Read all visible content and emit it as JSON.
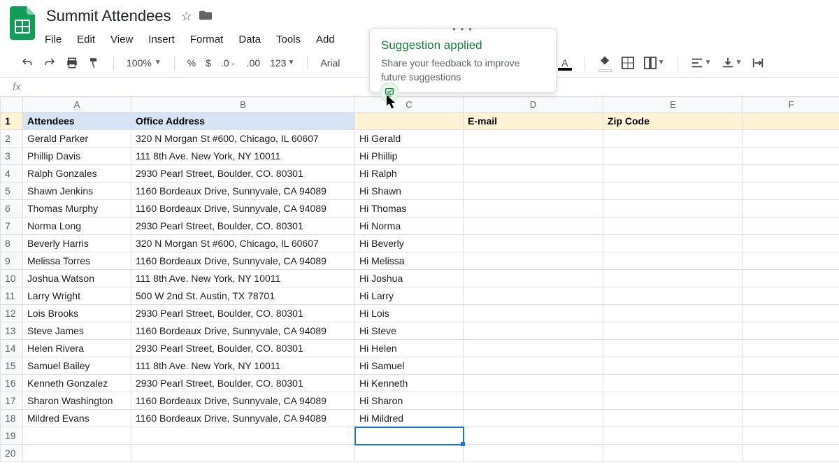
{
  "doc": {
    "title": "Summit Attendees"
  },
  "menu": {
    "file": "File",
    "edit": "Edit",
    "view": "View",
    "insert": "Insert",
    "format": "Format",
    "data": "Data",
    "tools": "Tools",
    "add": "Add"
  },
  "toolbar": {
    "zoom": "100%",
    "numfmt": "123",
    "font": "Arial"
  },
  "suggestion": {
    "title": "Suggestion applied",
    "body": "Share your feedback to improve future suggestions"
  },
  "columns": [
    "A",
    "B",
    "C",
    "D",
    "E",
    "F"
  ],
  "headers": {
    "A": "Attendees",
    "B": "Office Address",
    "C": "",
    "D": "E-mail",
    "E": "Zip Code",
    "F": ""
  },
  "rows": [
    {
      "n": "2",
      "a": "Gerald Parker",
      "b": "320 N Morgan St #600, Chicago, IL 60607",
      "c": "Hi Gerald"
    },
    {
      "n": "3",
      "a": "Phillip Davis",
      "b": "111 8th Ave. New York, NY 10011",
      "c": "Hi Phillip"
    },
    {
      "n": "4",
      "a": "Ralph Gonzales",
      "b": "2930 Pearl Street, Boulder, CO. 80301",
      "c": "Hi Ralph"
    },
    {
      "n": "5",
      "a": "Shawn Jenkins",
      "b": "1160 Bordeaux Drive, Sunnyvale, CA 94089",
      "c": "Hi Shawn"
    },
    {
      "n": "6",
      "a": "Thomas Murphy",
      "b": "1160 Bordeaux Drive, Sunnyvale, CA 94089",
      "c": "Hi Thomas"
    },
    {
      "n": "7",
      "a": "Norma Long",
      "b": "2930 Pearl Street, Boulder, CO. 80301",
      "c": "Hi Norma"
    },
    {
      "n": "8",
      "a": "Beverly Harris",
      "b": "320 N Morgan St #600, Chicago, IL 60607",
      "c": "Hi Beverly"
    },
    {
      "n": "9",
      "a": "Melissa Torres",
      "b": "1160 Bordeaux Drive, Sunnyvale, CA 94089",
      "c": "Hi Melissa"
    },
    {
      "n": "10",
      "a": "Joshua Watson",
      "b": "111 8th Ave. New York, NY 10011",
      "c": "Hi Joshua"
    },
    {
      "n": "11",
      "a": "Larry Wright",
      "b": "500 W 2nd St. Austin, TX 78701",
      "c": "Hi Larry"
    },
    {
      "n": "12",
      "a": "Lois Brooks",
      "b": "2930 Pearl Street, Boulder, CO. 80301",
      "c": "Hi Lois"
    },
    {
      "n": "13",
      "a": "Steve James",
      "b": "1160 Bordeaux Drive, Sunnyvale, CA 94089",
      "c": "Hi Steve"
    },
    {
      "n": "14",
      "a": "Helen Rivera",
      "b": "2930 Pearl Street, Boulder, CO. 80301",
      "c": "Hi Helen"
    },
    {
      "n": "15",
      "a": "Samuel Bailey",
      "b": "111 8th Ave. New York, NY 10011",
      "c": "Hi Samuel"
    },
    {
      "n": "16",
      "a": "Kenneth Gonzalez",
      "b": "2930 Pearl Street, Boulder, CO. 80301",
      "c": "Hi Kenneth"
    },
    {
      "n": "17",
      "a": "Sharon Washington",
      "b": "1160 Bordeaux Drive, Sunnyvale, CA 94089",
      "c": "Hi Sharon"
    },
    {
      "n": "18",
      "a": "Mildred Evans",
      "b": "1160 Bordeaux Drive, Sunnyvale, CA 94089",
      "c": "Hi Mildred"
    },
    {
      "n": "19",
      "a": "",
      "b": "",
      "c": ""
    },
    {
      "n": "20",
      "a": "",
      "b": "",
      "c": ""
    }
  ]
}
